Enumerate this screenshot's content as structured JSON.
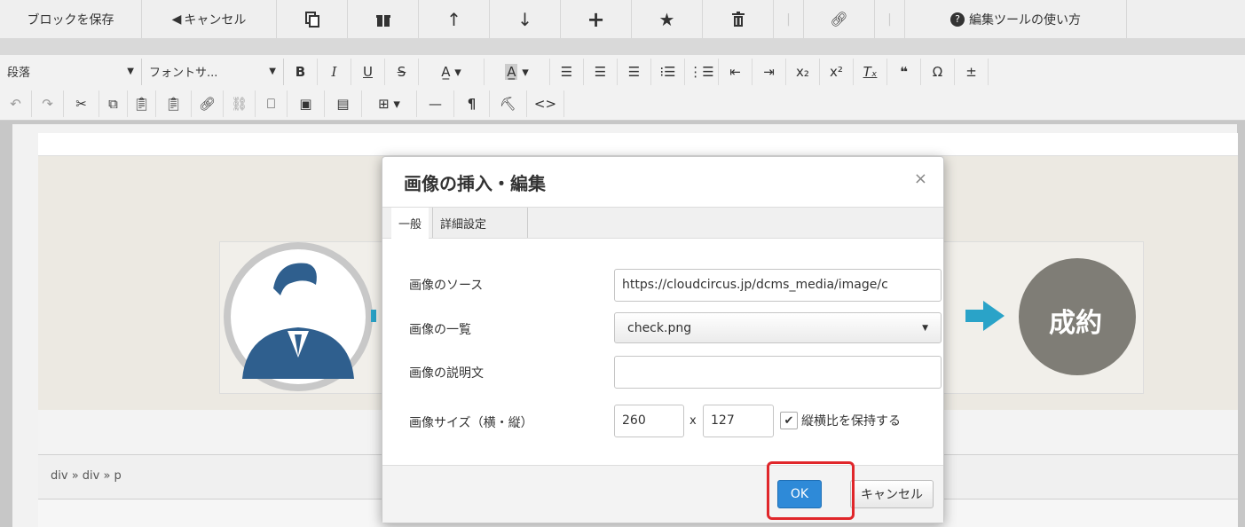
{
  "block_toolbar": {
    "save_label": "ブロックを保存",
    "cancel_label": "キャンセル",
    "help_label": "編集ツールの使い方"
  },
  "format_toolbar": {
    "paragraph_select": "段落",
    "font_size_select": "フォントサ..."
  },
  "editor": {
    "path": "div » div » p",
    "contract_label": "成約"
  },
  "dialog": {
    "title": "画像の挿入・編集",
    "close": "×",
    "tabs": [
      "一般",
      "詳細設定"
    ],
    "source_label": "画像のソース",
    "source_value": "https://cloudcircus.jp/dcms_media/image/c",
    "list_label": "画像の一覧",
    "list_value": "check.png",
    "description_label": "画像の説明文",
    "description_value": "",
    "size_label": "画像サイズ（横・縦）",
    "width": "260",
    "x_sep": "x",
    "height": "127",
    "keep_ratio_label": "縦横比を保持する",
    "ok_label": "OK",
    "cancel_label": "キャンセル"
  },
  "colors": {
    "ok_blue": "#2e8ad8",
    "highlight_red": "#e0262a",
    "person_navy": "#2f5f8e",
    "circle_gray": "#7f7d76",
    "arrow_teal": "#2aa3c8"
  }
}
